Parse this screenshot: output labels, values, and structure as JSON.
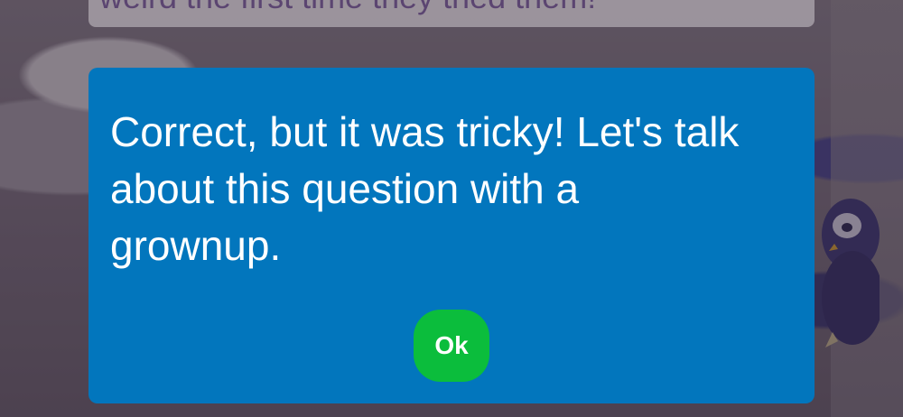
{
  "background": {
    "question_text": "weird the first time they tried them!"
  },
  "dialog": {
    "message": "Correct, but it was tricky! Let's talk about this question with a grownup.",
    "ok_label": "Ok"
  },
  "colors": {
    "dialog_background": "#0276bd",
    "ok_button": "#0bbd3c",
    "question_text": "#51386a"
  }
}
